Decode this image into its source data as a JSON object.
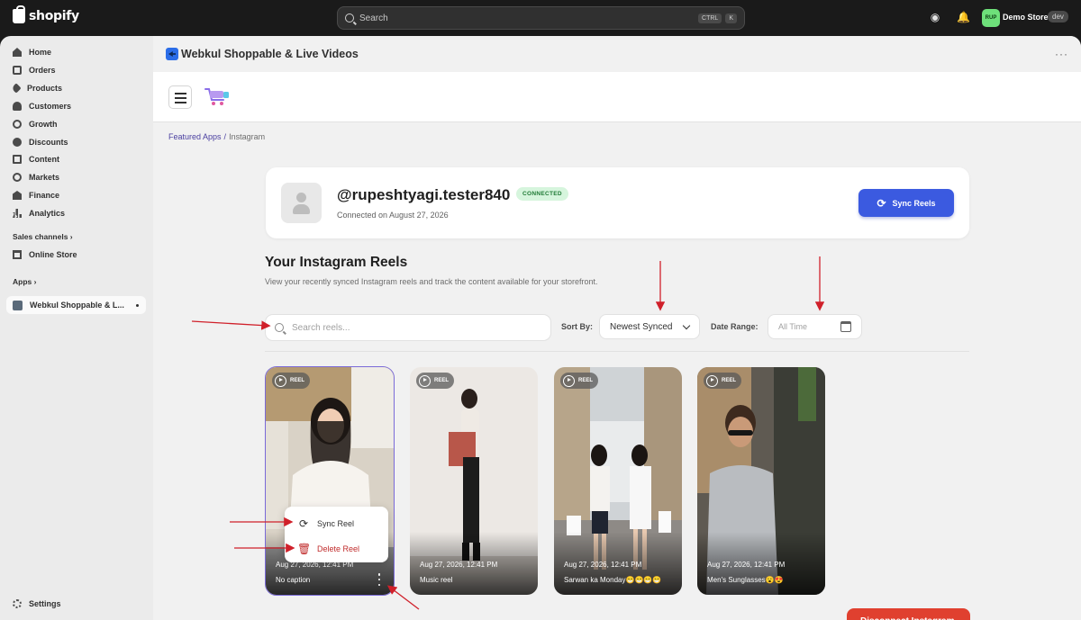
{
  "topbar": {
    "brand": "shopify",
    "search_placeholder": "Search",
    "shortcut_key1": "CTRL",
    "shortcut_key2": "K",
    "store_initials": "RUP",
    "store_name": "Demo Store",
    "store_env": "dev"
  },
  "sidebar": {
    "items": [
      {
        "label": "Home",
        "icon": "home-icon"
      },
      {
        "label": "Orders",
        "icon": "orders-icon"
      },
      {
        "label": "Products",
        "icon": "tag-icon"
      },
      {
        "label": "Customers",
        "icon": "person-icon"
      },
      {
        "label": "Growth",
        "icon": "gauge-icon"
      },
      {
        "label": "Discounts",
        "icon": "discount-icon"
      },
      {
        "label": "Content",
        "icon": "document-icon"
      },
      {
        "label": "Markets",
        "icon": "globe-icon"
      },
      {
        "label": "Finance",
        "icon": "bank-icon"
      },
      {
        "label": "Analytics",
        "icon": "bar-chart-icon"
      }
    ],
    "sales_channels_label": "Sales channels",
    "online_store_label": "Online Store",
    "apps_label": "Apps",
    "active_app_label": "Webkul Shoppable & L...",
    "settings_label": "Settings"
  },
  "app_header": {
    "title": "Webkul Shoppable & Live Videos",
    "more": "···"
  },
  "breadcrumb": {
    "parent": "Featured Apps",
    "separator": "/",
    "current": "Instagram"
  },
  "profile": {
    "username": "@rupeshtyagi.tester840",
    "status": "CONNECTED",
    "connected_on": "Connected on August 27, 2026",
    "sync_button": "Sync Reels"
  },
  "reels_section": {
    "title": "Your Instagram Reels",
    "subtitle": "View your recently synced Instagram reels and track the content available for your storefront.",
    "search_placeholder": "Search reels...",
    "sort_label": "Sort By:",
    "sort_value": "Newest Synced",
    "date_label": "Date Range:",
    "date_placeholder": "All Time"
  },
  "reels": [
    {
      "badge": "REEL",
      "date": "Aug 27, 2026, 12:41 PM",
      "caption": "No caption"
    },
    {
      "badge": "REEL",
      "date": "Aug 27, 2026, 12:41 PM",
      "caption": "Music reel"
    },
    {
      "badge": "REEL",
      "date": "Aug 27, 2026, 12:41 PM",
      "caption": "Sarwan ka Monday😁😁😁😁"
    },
    {
      "badge": "REEL",
      "date": "Aug 27, 2026, 12:41 PM",
      "caption": "Men's Sunglasses😮😍"
    }
  ],
  "reel_menu": {
    "sync": "Sync Reel",
    "delete": "Delete Reel"
  },
  "footer": {
    "disconnect_button": "Disconnect Instagram"
  },
  "colors": {
    "accent": "#3b5ae0",
    "danger": "#e0402f",
    "annotation": "#d0202a"
  }
}
